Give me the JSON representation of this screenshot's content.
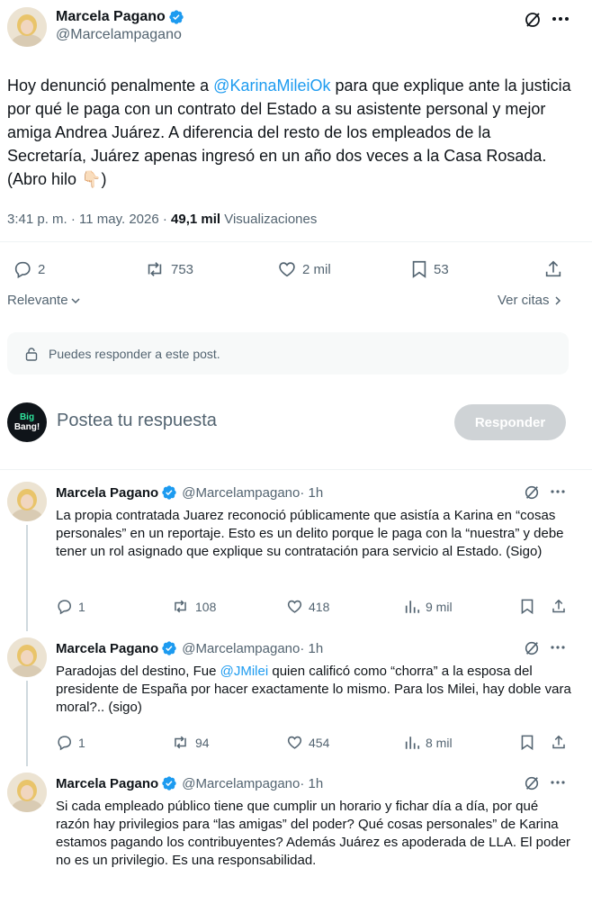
{
  "main_post": {
    "author_name": "Marcela Pagano",
    "author_handle": "@Marcelampagano",
    "text_before_mention": "Hoy denunció penalmente a ",
    "mention": "@KarinaMileiOk",
    "text_after_mention": " para que explique ante la justicia por qué le paga con un contrato del Estado a su asistente personal y mejor amiga Andrea Juárez. A diferencia del resto de los empleados de la Secretaría, Juárez apenas ingresó en un año dos veces a la Casa Rosada.  (Abro hilo ",
    "emoji": "👇🏻",
    "text_end": ")",
    "timestamp": "3:41 p. m. · 11 may. 2026 · ",
    "views_count": "49,1 mil",
    "views_label": " Visualizaciones",
    "replies": "2",
    "reposts": "753",
    "likes": "2 mil",
    "bookmarks": "53"
  },
  "sort": {
    "label": "Relevante",
    "quotes_link": "Ver citas"
  },
  "reply_restriction": "Puedes responder a este post.",
  "composer": {
    "avatar_text_1": "Big",
    "avatar_text_2": "Bang!",
    "placeholder": "Postea tu respuesta",
    "button": "Responder"
  },
  "replies": [
    {
      "author_name": "Marcela Pagano",
      "author_handle": "@Marcelampagano",
      "time": " · 1h",
      "text": "La propia contratada Juarez reconoció públicamente que asistía a Karina en “cosas personales” en un reportaje. Esto es un delito porque le paga con la “nuestra” y debe tener un rol asignado que explique su contratación para servicio al Estado. (Sigo)",
      "replies": "1",
      "reposts": "108",
      "likes": "418",
      "views": "9 mil"
    },
    {
      "author_name": "Marcela Pagano",
      "author_handle": "@Marcelampagano",
      "time": " · 1h",
      "text_before_mention": "Paradojas del destino, Fue ",
      "mention": "@JMilei",
      "text_after_mention": " quien calificó como “chorra” a la esposa del presidente de España por hacer exactamente lo mismo. Para los Milei, hay doble vara moral?.. (sigo)",
      "replies": "1",
      "reposts": "94",
      "likes": "454",
      "views": "8 mil"
    },
    {
      "author_name": "Marcela Pagano",
      "author_handle": "@Marcelampagano",
      "time": " · 1h",
      "text": "Si cada empleado público tiene que cumplir un horario y fichar día a día, por qué razón hay privilegios para “las amigas” del poder? Qué cosas personales” de Karina estamos pagando los contribuyentes? Además Juárez es apoderada de LLA. El poder no es un privilegio. Es una responsabilidad."
    }
  ],
  "colors": {
    "accent": "#1d9bf0",
    "text": "#0f1419",
    "muted": "#536471",
    "button_disabled": "#cfd3d6"
  }
}
